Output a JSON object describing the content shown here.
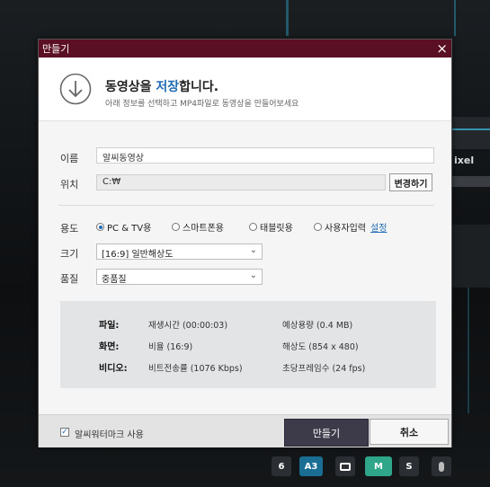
{
  "dialog": {
    "title": "만들기",
    "close_glyph": "×",
    "heading_pre": "동영상을 ",
    "heading_highlight": "저장",
    "heading_post": "합니다.",
    "subtitle": "아래 정보를 선택하고 MP4파일로 동영상을 만들어보세요",
    "icon": "download-circle-icon"
  },
  "form": {
    "name_label": "이름",
    "name_value": "알씨동영상",
    "location_label": "위치",
    "location_value": "C:₩",
    "change_button": "변경하기",
    "usage_label": "용도",
    "usage_options": [
      "PC & TV용",
      "스마트폰용",
      "태블릿용",
      "사용자입력"
    ],
    "usage_selected_index": 0,
    "settings_link": "설정",
    "size_label": "크기",
    "size_value": "[16:9] 일반해상도",
    "quality_label": "품질",
    "quality_value": "중품질",
    "chevron": "⌄"
  },
  "info": {
    "file_label": "파일:",
    "file_duration": "재생시간 (00:00:03)",
    "file_size": "예상용량 (0.4 MB)",
    "screen_label": "화면:",
    "screen_ratio": "비율 (16:9)",
    "screen_resolution": "해상도 (854 x 480)",
    "video_label": "비디오:",
    "video_bitrate": "비트전송률 (1076 Kbps)",
    "video_fps": "초당프레임수 (24 fps)"
  },
  "footer": {
    "watermark_label": "알씨워터마크 사용",
    "watermark_checked": true,
    "make_button": "만들기",
    "cancel_button": "취소"
  },
  "background": {
    "side_text_1": "ixel",
    "bottom_buttons": [
      "6",
      "A3",
      "",
      "M",
      "S",
      ""
    ]
  },
  "colors": {
    "titlebar": "#5b0f24",
    "accent": "#1f6bb5",
    "primary_button": "#3d3a4a"
  }
}
